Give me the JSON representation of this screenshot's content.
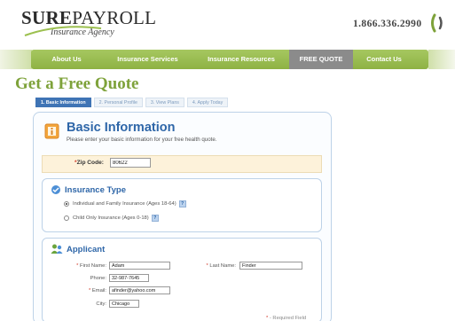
{
  "header": {
    "logo_brand_bold": "SURE",
    "logo_brand_rest": "PAYROLL",
    "logo_sub": "Insurance Agency",
    "phone": "1.866.336.2990"
  },
  "nav": {
    "items": [
      {
        "label": "About Us",
        "active": false
      },
      {
        "label": "Insurance Services",
        "active": false
      },
      {
        "label": "Insurance Resources",
        "active": false
      },
      {
        "label": "FREE QUOTE",
        "active": true
      },
      {
        "label": "Contact Us",
        "active": false
      }
    ]
  },
  "page_title": "Get a Free Quote",
  "steps": [
    {
      "label": "1. Basic Information",
      "active": true
    },
    {
      "label": "2. Personal Profile",
      "active": false
    },
    {
      "label": "3. View Plans",
      "active": false
    },
    {
      "label": "4. Apply Today",
      "active": false
    }
  ],
  "basic": {
    "title": "Basic Information",
    "subtitle": "Please enter your basic information for your free health quote."
  },
  "zip": {
    "required_mark": "*",
    "label": "Zip Code:",
    "value": "80622"
  },
  "insurance_type": {
    "title": "Insurance Type",
    "options": [
      {
        "label": "Individual and Family Insurance (Ages 18-64)",
        "checked": true
      },
      {
        "label": "Child Only Insurance (Ages 0-18)",
        "checked": false
      }
    ],
    "help_label": "?"
  },
  "applicant": {
    "title": "Applicant",
    "first_name": {
      "label": "First Name:",
      "value": "Adam",
      "required": true
    },
    "last_name": {
      "label": "Last Name:",
      "value": "Finder",
      "required": true
    },
    "phone": {
      "label": "Phone:",
      "value": "32-987-7645",
      "required": false
    },
    "email": {
      "label": "Email:",
      "value": "afinder@yahoo.com",
      "required": true
    },
    "city": {
      "label": "City:",
      "value": "Chicago",
      "required": false
    }
  },
  "required_note": {
    "mark": "*",
    "text": "- Required Field"
  },
  "colors": {
    "nav_green": "#8eb244",
    "title_green": "#7ea23a",
    "heading_blue": "#2e66a8",
    "required_red": "#d23b2a"
  }
}
